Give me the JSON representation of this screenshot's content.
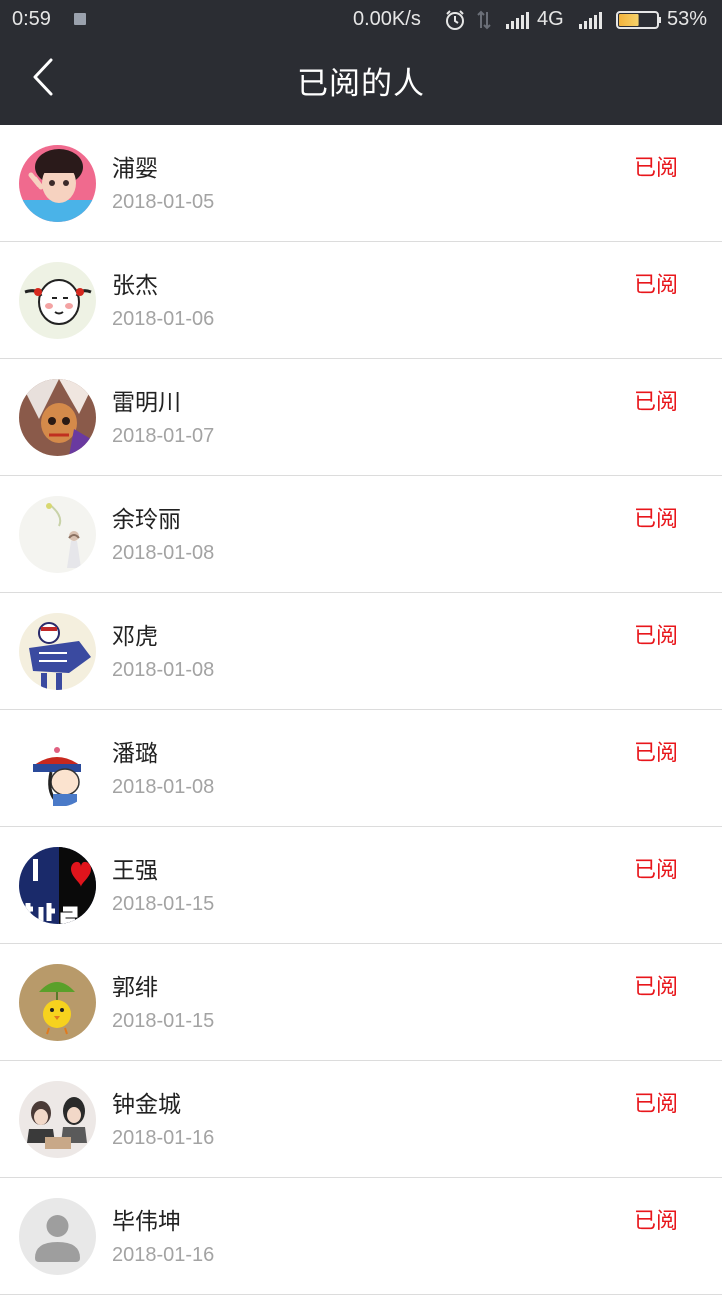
{
  "status_bar": {
    "time": "0:59",
    "speed": "0.00K/s",
    "network": "4G",
    "battery": "53%",
    "battery_level": 0.53
  },
  "header": {
    "title": "已阅的人"
  },
  "readers": [
    {
      "name": "浦婴",
      "date": "2018-01-05",
      "status": "已阅"
    },
    {
      "name": "张杰",
      "date": "2018-01-06",
      "status": "已阅"
    },
    {
      "name": "雷明川",
      "date": "2018-01-07",
      "status": "已阅"
    },
    {
      "name": "余玲丽",
      "date": "2018-01-08",
      "status": "已阅"
    },
    {
      "name": "邓虎",
      "date": "2018-01-08",
      "status": "已阅"
    },
    {
      "name": "潘璐",
      "date": "2018-01-08",
      "status": "已阅"
    },
    {
      "name": "王强",
      "date": "2018-01-15",
      "status": "已阅"
    },
    {
      "name": "郭绯",
      "date": "2018-01-15",
      "status": "已阅"
    },
    {
      "name": "钟金城",
      "date": "2018-01-16",
      "status": "已阅"
    },
    {
      "name": "毕伟坤",
      "date": "2018-01-16",
      "status": "已阅"
    }
  ],
  "colors": {
    "header_bg": "#2b2d33",
    "status_red": "#e8161b",
    "date_gray": "#a3a3a3"
  }
}
